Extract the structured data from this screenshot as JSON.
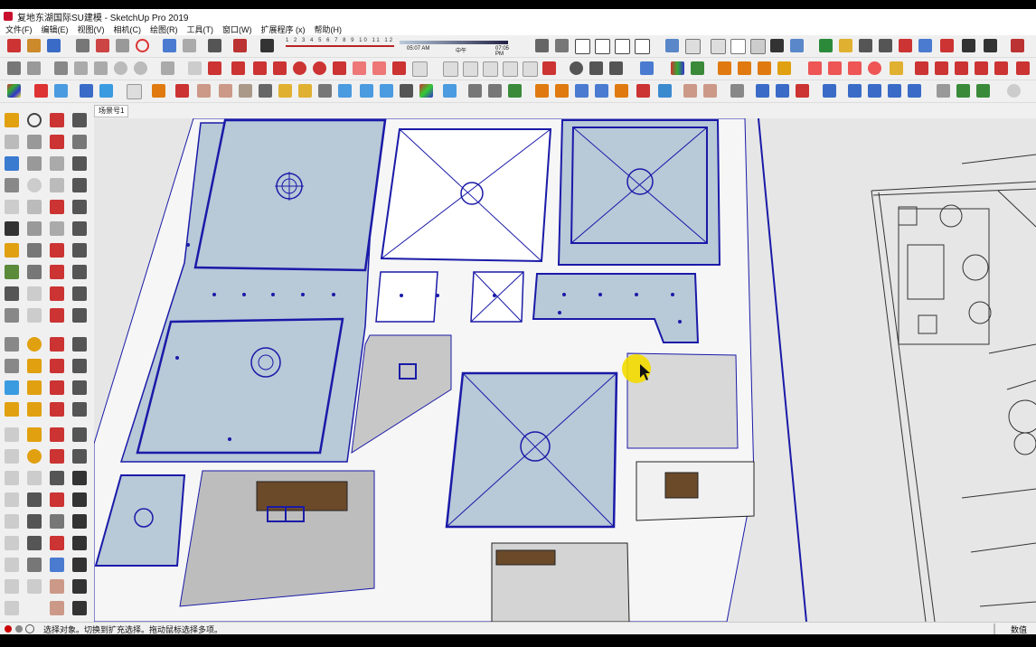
{
  "window": {
    "title": "复地东湖国际SU建模 - SketchUp Pro 2019"
  },
  "menu": [
    "文件(F)",
    "编辑(E)",
    "视图(V)",
    "相机(C)",
    "绘图(R)",
    "工具(T)",
    "窗口(W)",
    "扩展程序 (x)",
    "帮助(H)"
  ],
  "shadow_settings": {
    "months": [
      "1",
      "2",
      "3",
      "4",
      "5",
      "6",
      "7",
      "8",
      "9",
      "10",
      "11",
      "12"
    ],
    "time_start": "05:07 AM",
    "time_mid": "中午",
    "time_end": "07:05 PM"
  },
  "scene_tab": "场景号1",
  "status": {
    "message": "选择对象。切换到扩充选择。拖动鼠标选择多项。",
    "value_label": "数值"
  },
  "colors": {
    "selection_blue": "#1a1aa8",
    "ceiling_fill": "#b8c9d8",
    "wall_white": "#f6f6f6",
    "cursor_highlight": "#f3dc00"
  }
}
